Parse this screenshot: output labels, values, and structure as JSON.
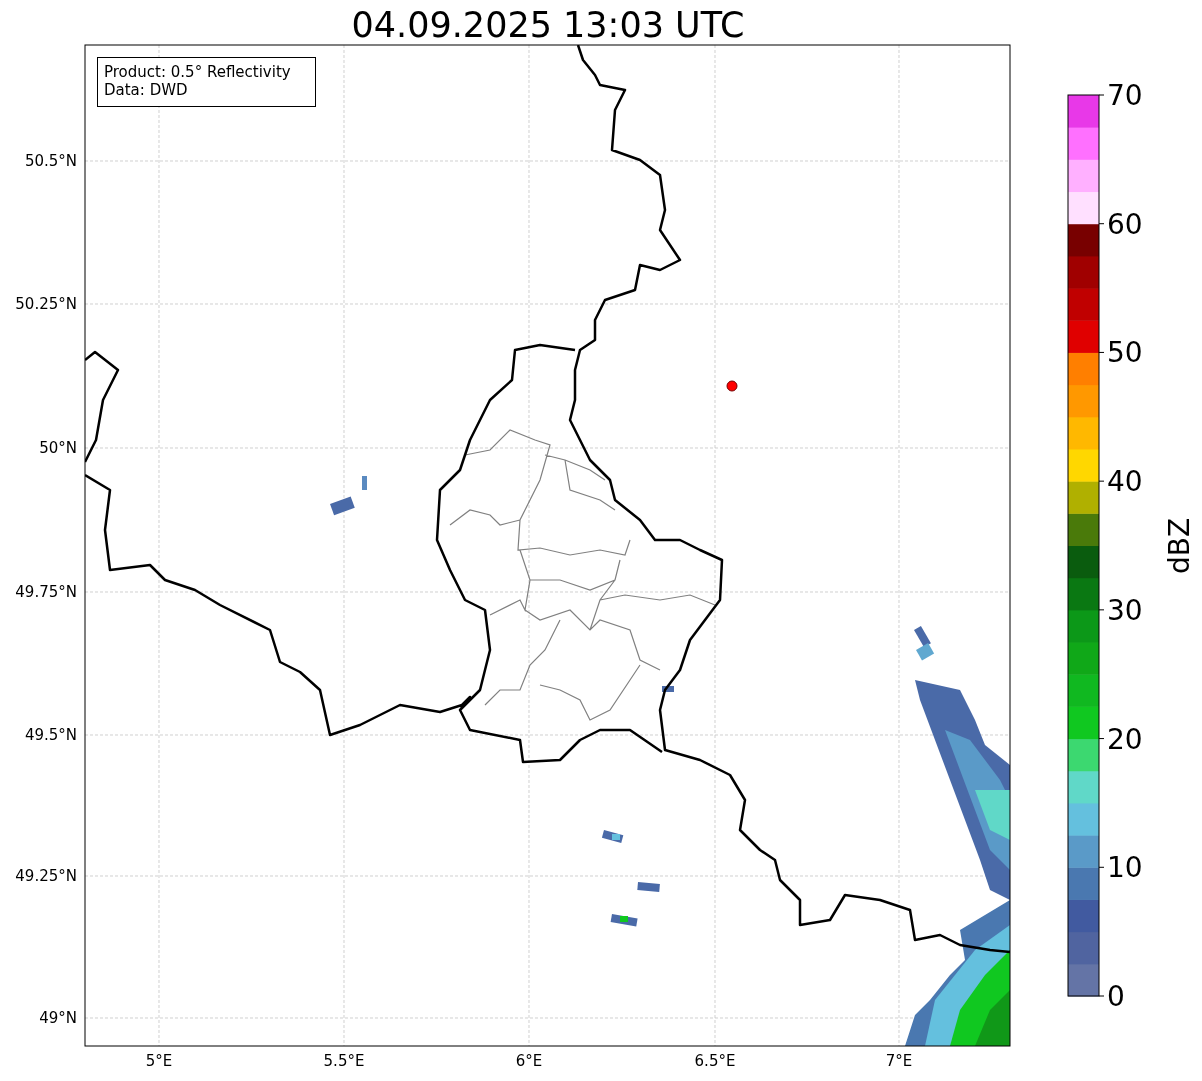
{
  "title": "04.09.2025 13:03 UTC",
  "info_box": [
    "Product: 0.5° Reflectivity",
    "Data: DWD"
  ],
  "map": {
    "lat_ticks": [
      "50.5°N",
      "50.25°N",
      "50°N",
      "49.75°N",
      "49.5°N",
      "49.25°N",
      "49°N"
    ],
    "lon_ticks": [
      "5°E",
      "5.5°E",
      "6°E",
      "6.5°E",
      "7°E"
    ]
  },
  "colorbar": {
    "label": "dBZ",
    "ticks": [
      "70",
      "60",
      "50",
      "40",
      "30",
      "20",
      "10",
      "0"
    ],
    "segments": [
      {
        "color": "#6474a6"
      },
      {
        "color": "#5064a0"
      },
      {
        "color": "#415aa0"
      },
      {
        "color": "#4a78b0"
      },
      {
        "color": "#5a9ac8"
      },
      {
        "color": "#64c0de"
      },
      {
        "color": "#60d8c8"
      },
      {
        "color": "#3cd870"
      },
      {
        "color": "#10c820"
      },
      {
        "color": "#10b820"
      },
      {
        "color": "#10a818"
      },
      {
        "color": "#0c9818"
      },
      {
        "color": "#0a7812"
      },
      {
        "color": "#0a5c0e"
      },
      {
        "color": "#4a7a0a"
      },
      {
        "color": "#b0b000"
      },
      {
        "color": "#ffd700"
      },
      {
        "color": "#ffb800"
      },
      {
        "color": "#ff9800"
      },
      {
        "color": "#ff7f00"
      },
      {
        "color": "#e00000"
      },
      {
        "color": "#c00000"
      },
      {
        "color": "#a00000"
      },
      {
        "color": "#780000"
      },
      {
        "color": "#ffe0ff"
      },
      {
        "color": "#ffb0ff"
      },
      {
        "color": "#ff70ff"
      },
      {
        "color": "#e838e8"
      }
    ]
  }
}
